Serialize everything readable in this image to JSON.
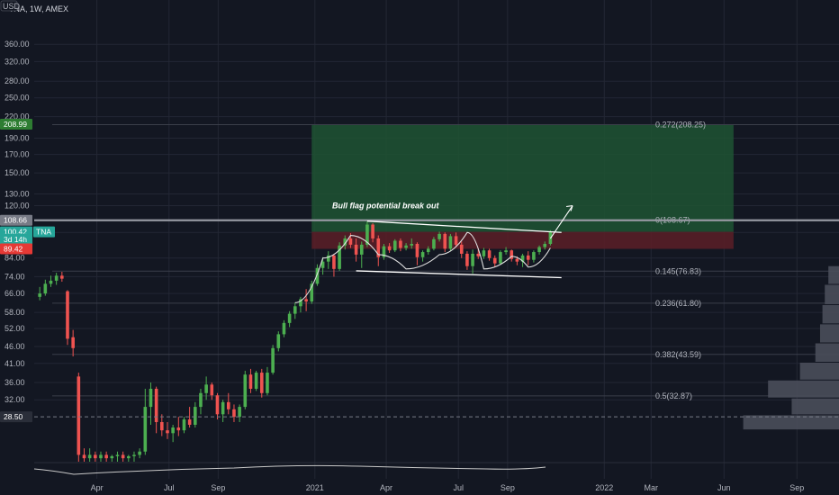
{
  "header": {
    "currency": "USD",
    "symbol_label": "TNA, 1W, AMEX"
  },
  "colors": {
    "background": "#131722",
    "grid": "#232734",
    "up": "#26a69a",
    "up_candle": "#4caf50",
    "down": "#ef5350",
    "target_zone": "#1f5433",
    "stop_zone": "#5c1f27",
    "fib_line": "#3a3e4a",
    "profile": "#4a4e5a"
  },
  "chart_data": {
    "type": "candlestick",
    "title": "TNA, 1W, AMEX",
    "y_scale": "log",
    "ylim": [
      21,
      400
    ],
    "y_ticks": [
      360,
      320,
      280,
      250,
      220,
      190,
      170,
      150,
      130,
      120,
      100,
      84,
      74,
      66,
      58,
      52,
      46,
      41,
      36,
      32
    ],
    "y_tick_labels": [
      "360.00",
      "320.00",
      "280.00",
      "250.00",
      "220.00",
      "190.00",
      "170.00",
      "150.00",
      "130.00",
      "120.00",
      "100.00",
      "84.00",
      "74.00",
      "66.00",
      "58.00",
      "52.00",
      "46.00",
      "41.00",
      "36.00",
      "32.00"
    ],
    "x_ticks": [
      "Apr",
      "Jul",
      "Sep",
      "2021",
      "Apr",
      "Jul",
      "Sep",
      "2022",
      "Mar",
      "Jun",
      "Sep"
    ],
    "x_range": [
      "2020-01-13",
      "2022-10-24"
    ],
    "x_tick_dates": [
      "2020-04-01",
      "2020-07-01",
      "2020-09-01",
      "2021-01-01",
      "2021-04-01",
      "2021-07-01",
      "2021-09-01",
      "2022-01-01",
      "2022-03-01",
      "2022-06-01",
      "2022-09-01"
    ],
    "price_badges": [
      {
        "label": "208.99",
        "value": 208.99,
        "color": "#2e7d32"
      },
      {
        "label": "108.66",
        "value": 108.66,
        "color": "#787b86"
      },
      {
        "label": "100.42",
        "value": 100.42,
        "color": "#26a69a"
      },
      {
        "label": "3d 14h",
        "value": 95.5,
        "color": "#26a69a"
      },
      {
        "label": "89.42",
        "value": 89.42,
        "color": "#e53935"
      },
      {
        "label": "28.50",
        "value": 28.5,
        "color": "#2a2e39"
      }
    ],
    "symbol_tag": "TNA",
    "fib_levels": [
      {
        "label": "0.272(208.25)",
        "value": 208.25
      },
      {
        "label": "0(108.67)",
        "value": 108.67
      },
      {
        "label": "0.145(76.83)",
        "value": 76.83
      },
      {
        "label": "0.236(61.80)",
        "value": 61.8
      },
      {
        "label": "0.382(43.59)",
        "value": 43.59
      },
      {
        "label": "0.5(32.87)",
        "value": 32.87
      }
    ],
    "position": {
      "start": "2020-12-28",
      "end": "2022-06-13",
      "entry": 100.42,
      "target": 208.99,
      "stop": 89.42
    },
    "annotation": "Bull flag potential break out",
    "horizontal_line": 108.66,
    "dashed_line": 28.5,
    "candles": [
      {
        "date": "2020-01-20",
        "o": 64.5,
        "h": 69.0,
        "l": 63.0,
        "c": 66.0
      },
      {
        "date": "2020-01-27",
        "o": 66.0,
        "h": 72.5,
        "l": 65.0,
        "c": 70.5
      },
      {
        "date": "2020-02-03",
        "o": 70.5,
        "h": 74.5,
        "l": 69.0,
        "c": 72.0
      },
      {
        "date": "2020-02-10",
        "o": 72.0,
        "h": 76.0,
        "l": 70.0,
        "c": 74.5
      },
      {
        "date": "2020-02-17",
        "o": 74.5,
        "h": 76.5,
        "l": 71.5,
        "c": 73.0
      },
      {
        "date": "2020-02-24",
        "o": 67.0,
        "h": 67.5,
        "l": 46.5,
        "c": 48.5
      },
      {
        "date": "2020-03-02",
        "o": 49.0,
        "h": 51.5,
        "l": 43.0,
        "c": 45.5
      },
      {
        "date": "2020-03-09",
        "o": 37.5,
        "h": 38.5,
        "l": 21.0,
        "c": 22.0
      },
      {
        "date": "2020-03-16",
        "o": 22.0,
        "h": 23.0,
        "l": 21.0,
        "c": 21.5
      },
      {
        "date": "2020-03-23",
        "o": 21.5,
        "h": 23.0,
        "l": 21.0,
        "c": 22.0
      },
      {
        "date": "2020-03-30",
        "o": 22.0,
        "h": 22.5,
        "l": 21.0,
        "c": 21.5
      },
      {
        "date": "2020-04-06",
        "o": 21.5,
        "h": 22.5,
        "l": 21.0,
        "c": 22.0
      },
      {
        "date": "2020-04-13",
        "o": 22.0,
        "h": 22.5,
        "l": 21.0,
        "c": 21.5
      },
      {
        "date": "2020-04-20",
        "o": 21.5,
        "h": 22.0,
        "l": 21.0,
        "c": 21.8
      },
      {
        "date": "2020-04-27",
        "o": 21.8,
        "h": 22.5,
        "l": 21.0,
        "c": 22.0
      },
      {
        "date": "2020-05-04",
        "o": 22.0,
        "h": 22.5,
        "l": 21.0,
        "c": 21.5
      },
      {
        "date": "2020-05-11",
        "o": 21.5,
        "h": 22.0,
        "l": 21.0,
        "c": 21.8
      },
      {
        "date": "2020-05-18",
        "o": 21.8,
        "h": 22.5,
        "l": 21.0,
        "c": 22.0
      },
      {
        "date": "2020-05-25",
        "o": 22.0,
        "h": 23.0,
        "l": 21.5,
        "c": 22.5
      },
      {
        "date": "2020-06-01",
        "o": 22.5,
        "h": 34.5,
        "l": 22.0,
        "c": 30.5
      },
      {
        "date": "2020-06-08",
        "o": 30.5,
        "h": 36.0,
        "l": 27.0,
        "c": 34.5
      },
      {
        "date": "2020-06-15",
        "o": 34.5,
        "h": 35.0,
        "l": 25.5,
        "c": 27.5
      },
      {
        "date": "2020-06-22",
        "o": 27.5,
        "h": 29.0,
        "l": 25.0,
        "c": 26.0
      },
      {
        "date": "2020-06-29",
        "o": 26.0,
        "h": 27.5,
        "l": 24.5,
        "c": 25.5
      },
      {
        "date": "2020-07-06",
        "o": 25.5,
        "h": 27.0,
        "l": 24.0,
        "c": 26.5
      },
      {
        "date": "2020-07-13",
        "o": 26.5,
        "h": 28.5,
        "l": 25.0,
        "c": 26.0
      },
      {
        "date": "2020-07-20",
        "o": 26.0,
        "h": 28.5,
        "l": 25.5,
        "c": 28.0
      },
      {
        "date": "2020-07-27",
        "o": 28.0,
        "h": 30.5,
        "l": 26.5,
        "c": 27.0
      },
      {
        "date": "2020-08-03",
        "o": 27.0,
        "h": 31.5,
        "l": 26.5,
        "c": 30.5
      },
      {
        "date": "2020-08-10",
        "o": 30.5,
        "h": 34.5,
        "l": 29.0,
        "c": 33.5
      },
      {
        "date": "2020-08-17",
        "o": 33.5,
        "h": 37.5,
        "l": 32.0,
        "c": 35.5
      },
      {
        "date": "2020-08-24",
        "o": 35.5,
        "h": 36.0,
        "l": 32.0,
        "c": 33.0
      },
      {
        "date": "2020-08-31",
        "o": 33.0,
        "h": 33.5,
        "l": 28.0,
        "c": 29.0
      },
      {
        "date": "2020-09-07",
        "o": 29.0,
        "h": 32.0,
        "l": 27.5,
        "c": 31.5
      },
      {
        "date": "2020-09-14",
        "o": 31.5,
        "h": 33.5,
        "l": 29.0,
        "c": 30.0
      },
      {
        "date": "2020-09-21",
        "o": 30.0,
        "h": 31.0,
        "l": 27.5,
        "c": 28.5
      },
      {
        "date": "2020-09-28",
        "o": 28.5,
        "h": 31.0,
        "l": 27.5,
        "c": 30.5
      },
      {
        "date": "2020-10-05",
        "o": 30.5,
        "h": 39.0,
        "l": 30.0,
        "c": 38.0
      },
      {
        "date": "2020-10-12",
        "o": 38.0,
        "h": 39.5,
        "l": 33.5,
        "c": 34.5
      },
      {
        "date": "2020-10-19",
        "o": 34.5,
        "h": 39.0,
        "l": 34.0,
        "c": 38.5
      },
      {
        "date": "2020-10-26",
        "o": 38.5,
        "h": 39.5,
        "l": 32.5,
        "c": 33.5
      },
      {
        "date": "2020-11-02",
        "o": 33.5,
        "h": 40.0,
        "l": 33.0,
        "c": 38.5
      },
      {
        "date": "2020-11-09",
        "o": 38.5,
        "h": 46.5,
        "l": 38.0,
        "c": 45.5
      },
      {
        "date": "2020-11-16",
        "o": 45.5,
        "h": 51.0,
        "l": 44.5,
        "c": 50.0
      },
      {
        "date": "2020-11-23",
        "o": 50.0,
        "h": 55.0,
        "l": 49.0,
        "c": 54.0
      },
      {
        "date": "2020-11-30",
        "o": 54.0,
        "h": 58.5,
        "l": 52.5,
        "c": 57.5
      },
      {
        "date": "2020-12-07",
        "o": 57.5,
        "h": 62.0,
        "l": 55.5,
        "c": 60.5
      },
      {
        "date": "2020-12-14",
        "o": 60.5,
        "h": 64.5,
        "l": 58.0,
        "c": 63.5
      },
      {
        "date": "2020-12-21",
        "o": 63.5,
        "h": 68.0,
        "l": 58.5,
        "c": 62.5
      },
      {
        "date": "2020-12-28",
        "o": 62.5,
        "h": 72.0,
        "l": 61.5,
        "c": 70.5
      },
      {
        "date": "2021-01-04",
        "o": 70.5,
        "h": 80.5,
        "l": 69.5,
        "c": 78.5
      },
      {
        "date": "2021-01-11",
        "o": 78.5,
        "h": 84.5,
        "l": 75.0,
        "c": 82.0
      },
      {
        "date": "2021-01-18",
        "o": 82.0,
        "h": 88.0,
        "l": 78.0,
        "c": 85.5
      },
      {
        "date": "2021-01-25",
        "o": 85.5,
        "h": 86.5,
        "l": 74.0,
        "c": 78.0
      },
      {
        "date": "2021-02-01",
        "o": 78.0,
        "h": 93.5,
        "l": 77.0,
        "c": 91.5
      },
      {
        "date": "2021-02-08",
        "o": 91.5,
        "h": 98.0,
        "l": 89.0,
        "c": 96.0
      },
      {
        "date": "2021-02-15",
        "o": 96.0,
        "h": 99.5,
        "l": 90.0,
        "c": 92.0
      },
      {
        "date": "2021-02-22",
        "o": 92.0,
        "h": 96.0,
        "l": 82.0,
        "c": 86.0
      },
      {
        "date": "2021-03-01",
        "o": 86.0,
        "h": 94.0,
        "l": 78.5,
        "c": 92.0
      },
      {
        "date": "2021-03-08",
        "o": 92.0,
        "h": 108.5,
        "l": 90.5,
        "c": 105.5
      },
      {
        "date": "2021-03-15",
        "o": 105.5,
        "h": 106.5,
        "l": 93.5,
        "c": 96.0
      },
      {
        "date": "2021-03-22",
        "o": 96.0,
        "h": 98.0,
        "l": 79.5,
        "c": 84.5
      },
      {
        "date": "2021-03-29",
        "o": 84.5,
        "h": 92.5,
        "l": 83.0,
        "c": 91.0
      },
      {
        "date": "2021-04-05",
        "o": 91.0,
        "h": 93.0,
        "l": 87.0,
        "c": 88.5
      },
      {
        "date": "2021-04-12",
        "o": 88.5,
        "h": 95.5,
        "l": 87.5,
        "c": 94.5
      },
      {
        "date": "2021-04-19",
        "o": 94.5,
        "h": 96.0,
        "l": 88.0,
        "c": 90.0
      },
      {
        "date": "2021-04-26",
        "o": 90.0,
        "h": 93.0,
        "l": 88.5,
        "c": 91.5
      },
      {
        "date": "2021-05-03",
        "o": 91.5,
        "h": 96.0,
        "l": 89.5,
        "c": 92.5
      },
      {
        "date": "2021-05-10",
        "o": 92.5,
        "h": 93.5,
        "l": 80.0,
        "c": 84.5
      },
      {
        "date": "2021-05-17",
        "o": 84.5,
        "h": 88.5,
        "l": 82.0,
        "c": 87.5
      },
      {
        "date": "2021-05-24",
        "o": 87.5,
        "h": 91.0,
        "l": 86.0,
        "c": 89.5
      },
      {
        "date": "2021-05-31",
        "o": 89.5,
        "h": 97.0,
        "l": 88.5,
        "c": 95.5
      },
      {
        "date": "2021-06-07",
        "o": 95.5,
        "h": 100.5,
        "l": 94.0,
        "c": 99.0
      },
      {
        "date": "2021-06-14",
        "o": 99.0,
        "h": 100.0,
        "l": 87.5,
        "c": 89.5
      },
      {
        "date": "2021-06-21",
        "o": 89.5,
        "h": 99.0,
        "l": 88.0,
        "c": 97.5
      },
      {
        "date": "2021-06-28",
        "o": 97.5,
        "h": 100.0,
        "l": 90.5,
        "c": 92.0
      },
      {
        "date": "2021-07-05",
        "o": 92.0,
        "h": 94.0,
        "l": 84.0,
        "c": 86.5
      },
      {
        "date": "2021-07-12",
        "o": 86.5,
        "h": 88.0,
        "l": 77.5,
        "c": 79.5
      },
      {
        "date": "2021-07-19",
        "o": 79.5,
        "h": 89.0,
        "l": 75.5,
        "c": 86.5
      },
      {
        "date": "2021-07-26",
        "o": 86.5,
        "h": 89.5,
        "l": 83.5,
        "c": 85.0
      },
      {
        "date": "2021-08-02",
        "o": 85.0,
        "h": 90.0,
        "l": 83.5,
        "c": 88.5
      },
      {
        "date": "2021-08-09",
        "o": 88.5,
        "h": 89.5,
        "l": 82.5,
        "c": 84.0
      },
      {
        "date": "2021-08-16",
        "o": 84.0,
        "h": 85.5,
        "l": 79.0,
        "c": 81.0
      },
      {
        "date": "2021-08-23",
        "o": 81.0,
        "h": 88.5,
        "l": 80.5,
        "c": 87.5
      },
      {
        "date": "2021-08-30",
        "o": 87.5,
        "h": 90.5,
        "l": 86.0,
        "c": 88.5
      },
      {
        "date": "2021-09-06",
        "o": 88.5,
        "h": 89.0,
        "l": 82.0,
        "c": 83.5
      },
      {
        "date": "2021-09-13",
        "o": 83.5,
        "h": 85.0,
        "l": 80.0,
        "c": 82.0
      },
      {
        "date": "2021-09-20",
        "o": 82.0,
        "h": 86.5,
        "l": 79.0,
        "c": 85.5
      },
      {
        "date": "2021-09-27",
        "o": 85.5,
        "h": 88.0,
        "l": 80.0,
        "c": 83.0
      },
      {
        "date": "2021-10-04",
        "o": 83.0,
        "h": 88.5,
        "l": 81.5,
        "c": 87.5
      },
      {
        "date": "2021-10-11",
        "o": 87.5,
        "h": 91.5,
        "l": 86.0,
        "c": 90.5
      },
      {
        "date": "2021-10-18",
        "o": 90.5,
        "h": 94.0,
        "l": 89.0,
        "c": 92.5
      },
      {
        "date": "2021-10-25",
        "o": 92.5,
        "h": 101.5,
        "l": 91.5,
        "c": 100.4
      }
    ],
    "volume_profile": [
      {
        "price_low": 26.0,
        "price_high": 28.8,
        "width": 0.81
      },
      {
        "price_low": 28.8,
        "price_high": 32.3,
        "width": 0.4
      },
      {
        "price_low": 32.3,
        "price_high": 36.5,
        "width": 0.6
      },
      {
        "price_low": 36.5,
        "price_high": 41.2,
        "width": 0.33
      },
      {
        "price_low": 41.2,
        "price_high": 47.0,
        "width": 0.2
      },
      {
        "price_low": 47.0,
        "price_high": 53.5,
        "width": 0.16
      },
      {
        "price_low": 53.5,
        "price_high": 61.0,
        "width": 0.14
      },
      {
        "price_low": 61.0,
        "price_high": 70.0,
        "width": 0.12
      },
      {
        "price_low": 70.0,
        "price_high": 79.5,
        "width": 0.09
      }
    ]
  }
}
